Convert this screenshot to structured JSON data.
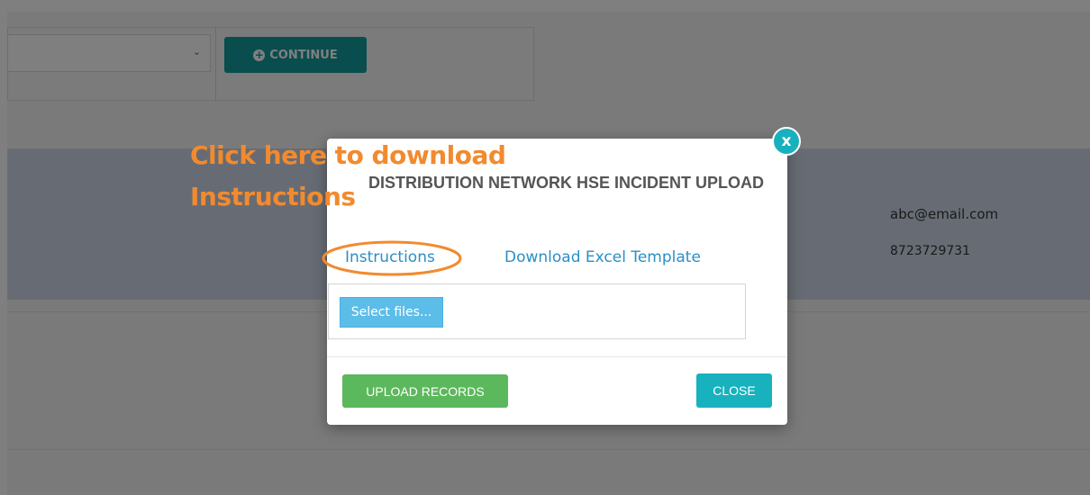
{
  "background": {
    "continue_label": "CONTINUE",
    "email": "abc@email.com",
    "phone": "8723729731"
  },
  "annotation": {
    "text": "Click here to download\nInstructions",
    "color": "#f28a2e"
  },
  "modal": {
    "title": "DISTRIBUTION NETWORK HSE INCIDENT UPLOAD",
    "instructions_link": "Instructions",
    "template_link": "Download Excel Template",
    "select_files_label": "Select files...",
    "upload_label": "UPLOAD RECORDS",
    "close_label": "CLOSE",
    "close_icon": "x",
    "accent_color": "#19b0bd",
    "upload_color": "#5cb85c"
  }
}
